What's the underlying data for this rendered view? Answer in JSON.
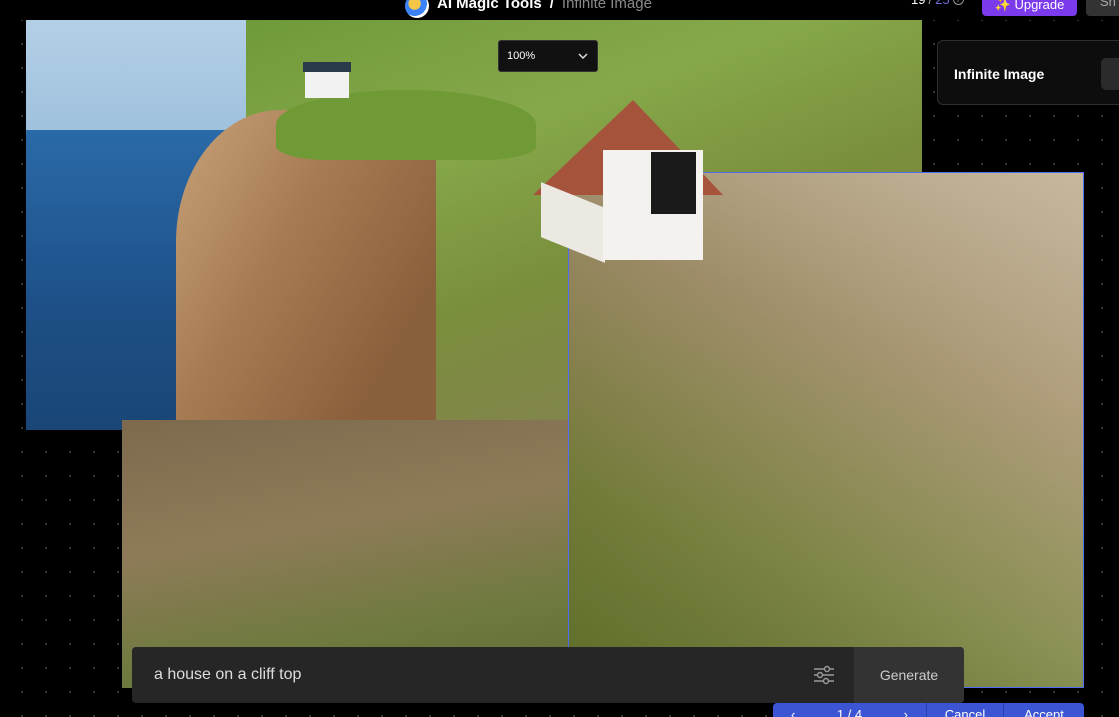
{
  "header": {
    "app_name": "AI Magic Tools",
    "separator": "/",
    "page_name": "Infinite Image",
    "credits_used": "19",
    "credits_sep": "/",
    "credits_total": "25",
    "upgrade_label": "✨ Upgrade",
    "share_label": "Sh"
  },
  "canvas": {
    "zoom_value": "100%"
  },
  "panel": {
    "title": "Infinite Image"
  },
  "prompt": {
    "value": "a house on a cliff top",
    "generate_label": "Generate"
  },
  "result_nav": {
    "prev": "‹",
    "counter": "1 / 4",
    "next": "›",
    "cancel_label": "Cancel",
    "accept_label": "Accept"
  },
  "colors": {
    "accent": "#7c3aed",
    "selection": "#4f6df0",
    "nav_bg": "#3b55d4"
  }
}
